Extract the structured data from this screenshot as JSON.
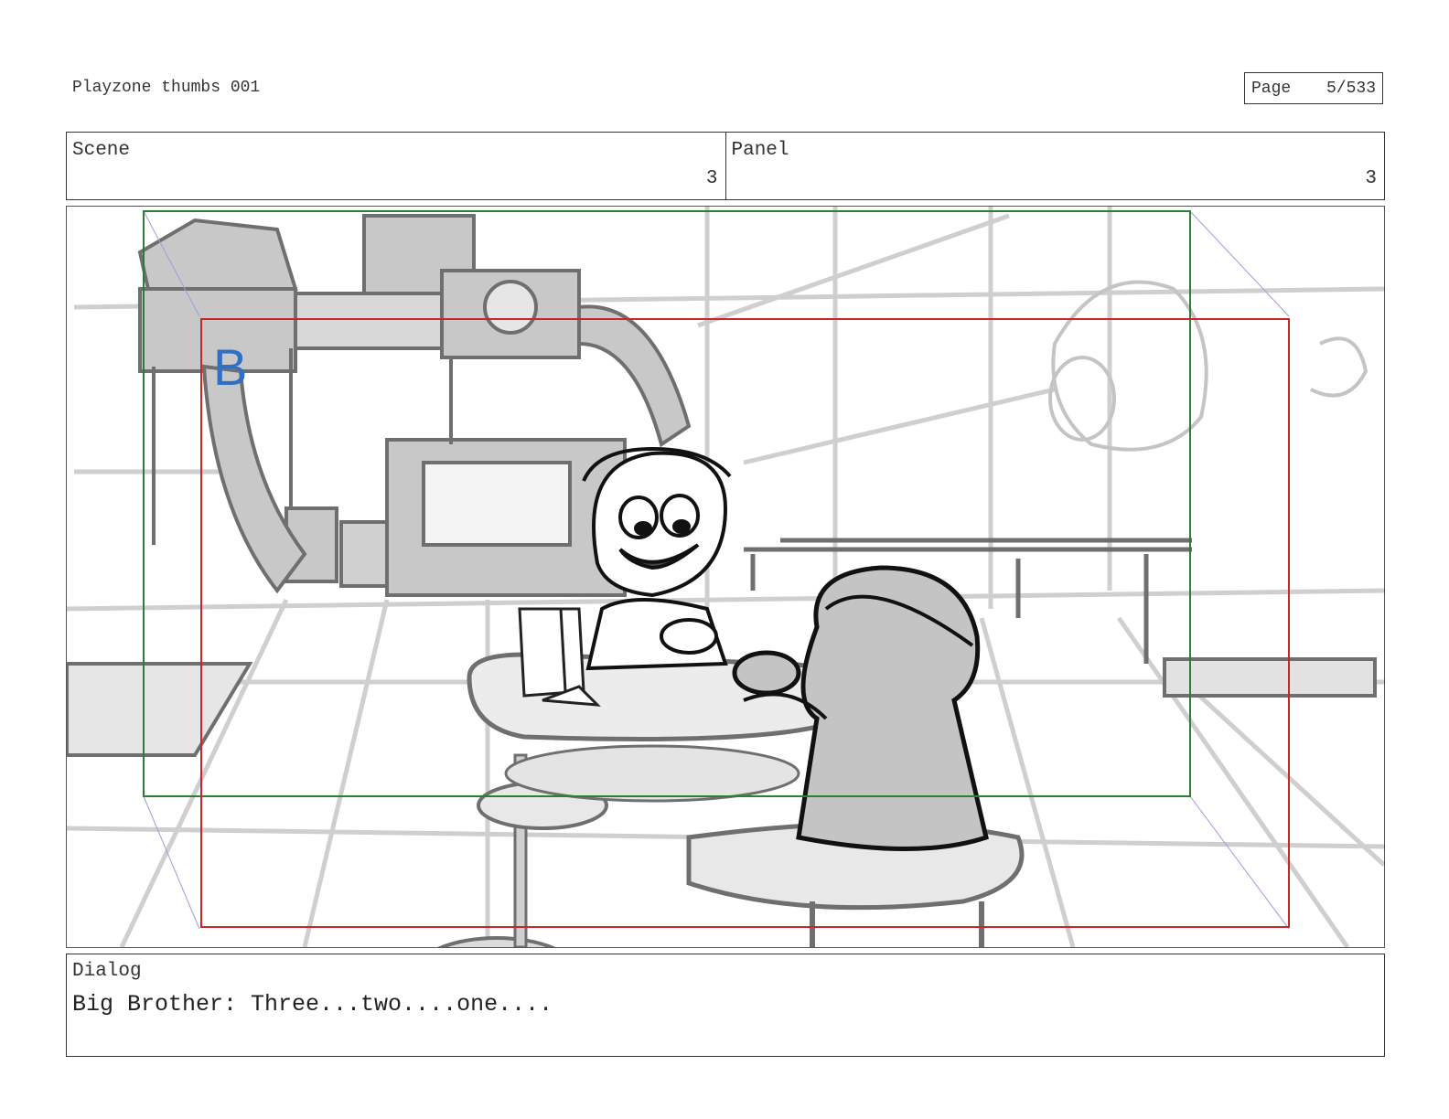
{
  "document": {
    "title": "Playzone thumbs 001",
    "page_label": "Page",
    "page_number": "5/533"
  },
  "header": {
    "scene_label": "Scene",
    "scene_value": "3",
    "panel_label": "Panel",
    "panel_value": "3"
  },
  "panel": {
    "layer_marker": "B",
    "safe_frame_color": "#2e7d32",
    "action_frame_color": "#c62828",
    "marker_color": "#2f6fc4"
  },
  "dialog": {
    "label": "Dialog",
    "text": "Big Brother: Three...two....one...."
  }
}
